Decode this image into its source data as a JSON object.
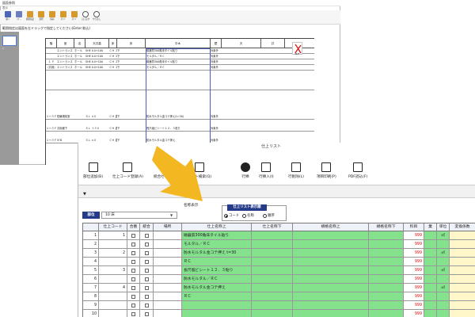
{
  "top_window": {
    "title": "図面参照",
    "ribbon_tab": "表示",
    "ribbon_buttons": [
      "開く",
      "ｺﾋﾟｰ",
      "範囲指定",
      "選択",
      "保存",
      "ｽﾗｲﾄﾞ",
      "ｽﾗｲﾄﾞ",
      "元に戻す",
      "やり直し"
    ],
    "hint": "範囲指定は図面を左ドラッグで指定してください(Enter:取込)",
    "thumbnail_label": "1",
    "doc_headers": [
      "階",
      "室",
      "名",
      "天井高",
      "床",
      "床",
      "巾木",
      "壁",
      "天",
      "井",
      "備考"
    ],
    "doc_rows": [
      {
        "floor": "",
        "room": "エントランス",
        "c1": "ホール",
        "c2": "SHE  0.0+100",
        "c3": "ＣＨ  ２，４８０",
        "c4": "下",
        "finish": "磁器質300角床タイル貼り",
        "note": "対象外"
      },
      {
        "floor": "",
        "room": "エントランス",
        "c1": "ホール",
        "c2": "SHE  0.0+100",
        "c3": "ＣＨ  ２，４８０",
        "c4": "下",
        "finish": "モルタル／ＲＣ",
        "note": "対象外"
      },
      {
        "floor": "１  Ｆ",
        "room": "エントランス",
        "c1": "ホール",
        "c2": "SHE  0.0+100",
        "c3": "ＣＨ  ２，４８０",
        "c4": "下",
        "finish": "磁器質300角床タイル貼り",
        "note": "対象外"
      },
      {
        "floor": "(共用)",
        "room": "エントランス",
        "c1": "ホール",
        "c2": "SHE  0.0+100",
        "c3": "ＣＨ  ２，４８０",
        "c4": "下",
        "finish": "モルタル／ＲＣ",
        "note": "対象外"
      },
      {
        "floor": "",
        "room": "",
        "c1": "",
        "c2": "",
        "c3": "",
        "c4": "",
        "finish": "",
        "note": ""
      },
      {
        "floor": "１～３Ｆ",
        "room": "駐輪場前室",
        "c1": "",
        "c2": "ＳＬ  ±０",
        "c3": "ＣＨ  直  天",
        "c4": "下",
        "finish": "防水モルタル金コテ押え(t=30)",
        "note": "対象外"
      },
      {
        "floor": "１～３Ｆ",
        "room": "共用廊下",
        "c1": "",
        "c2": "ＳＬ  ＋３０",
        "c3": "ＣＨ  直  天",
        "c4": "下",
        "finish": "長尺塩ビシート１２．３粘り",
        "note": "対象外"
      },
      {
        "floor": "１～３Ｆ",
        "room": "ＭＢ",
        "c1": "",
        "c2": "ＳＬ  ±０",
        "c3": "ＣＨ  直  天",
        "c4": "下",
        "finish": "防水モルタル金コテ押え",
        "note": "対象外"
      }
    ]
  },
  "bottom_window": {
    "title": "仕上リスト",
    "toolbar": [
      {
        "label": "部位追加(B)",
        "icon": "add-part-icon"
      },
      {
        "label": "仕上コード登録(A)",
        "icon": "code-register-icon"
      },
      {
        "label": "統合セット(S)",
        "icon": "merge-set-icon"
      },
      {
        "label": "リスト検索(Q)",
        "icon": "list-search-icon"
      },
      {
        "label": "行挿",
        "icon": "row-insert-icon"
      },
      {
        "label": "行挿入(I)",
        "icon": "row-insert-2-icon"
      },
      {
        "label": "行削除(L)",
        "icon": "row-delete-icon"
      },
      {
        "label": "項目印刷(P)",
        "icon": "print-icon"
      },
      {
        "label": "PDF読込(F)",
        "icon": "pdf-import-icon"
      }
    ],
    "strip_mark": "▼",
    "header_label": "名称表示",
    "bui_label": "部位",
    "bui_value": "10  床",
    "display_title": "仕上リスト表示順",
    "radio_options": [
      {
        "label": "コード",
        "selected": true
      },
      {
        "label": "名称",
        "selected": false
      },
      {
        "label": "順序",
        "selected": false
      }
    ],
    "grid_headers": [
      "",
      "仕上コード",
      "合番",
      "統合",
      "場所",
      "仕上名称上",
      "仕上名称下",
      "規格名称上",
      "規格名称下",
      "料目",
      "業",
      "単位",
      "変換係数"
    ],
    "grid_rows": [
      {
        "n": "1",
        "code": "1",
        "place": "",
        "upper": "磁器質300角床タイル貼り",
        "price": "999",
        "unit": "㎡"
      },
      {
        "n": "2",
        "code": "",
        "place": "",
        "upper": "モルタル／ＲＣ",
        "price": "999",
        "unit": ""
      },
      {
        "n": "3",
        "code": "2",
        "place": "",
        "upper": "防水モルタル金コテ押え t=30",
        "price": "999",
        "unit": "㎡"
      },
      {
        "n": "4",
        "code": "",
        "place": "",
        "upper": "ＲＣ",
        "price": "999",
        "unit": ""
      },
      {
        "n": "5",
        "code": "3",
        "place": "",
        "upper": "長尺塩ビシート１２．３粘り",
        "price": "999",
        "unit": "㎡"
      },
      {
        "n": "6",
        "code": "",
        "place": "",
        "upper": "防水モルタル／ＲＣ",
        "price": "999",
        "unit": ""
      },
      {
        "n": "7",
        "code": "4",
        "place": "",
        "upper": "防水モルタル金コテ押え",
        "price": "999",
        "unit": "㎡"
      },
      {
        "n": "8",
        "code": "",
        "place": "",
        "upper": "ＲＣ",
        "price": "999",
        "unit": ""
      },
      {
        "n": "9",
        "code": "",
        "place": "",
        "upper": "",
        "price": "999",
        "unit": ""
      },
      {
        "n": "10",
        "code": "",
        "place": "",
        "upper": "",
        "price": "999",
        "unit": ""
      }
    ]
  },
  "colors": {
    "accent_blue": "#253b8a",
    "grid_green": "#84e18c",
    "price_red": "#d11",
    "arrow_yellow": "#f3b722"
  }
}
